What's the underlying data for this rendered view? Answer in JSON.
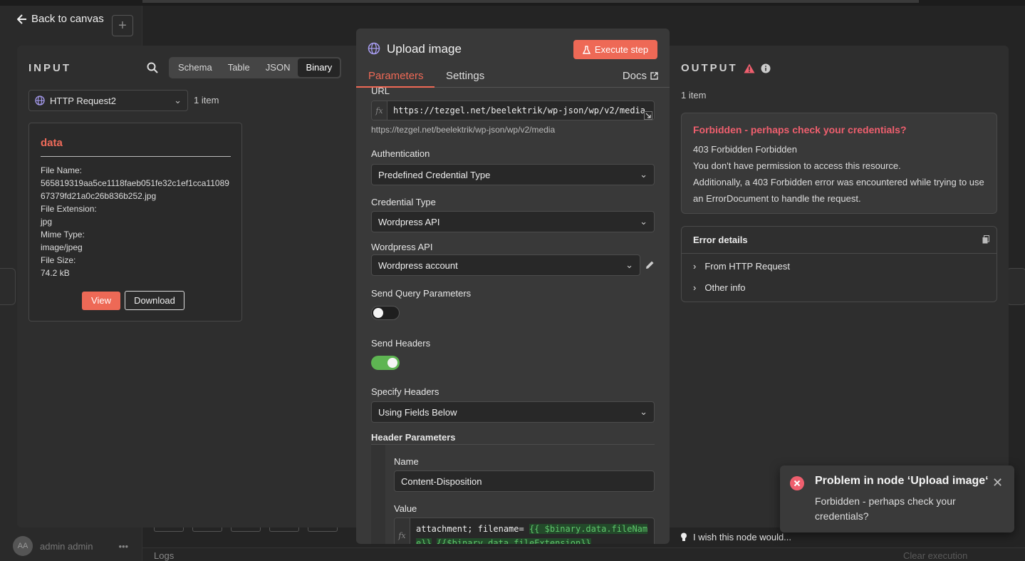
{
  "background": {
    "back_label": "Back to canvas",
    "user_name": "admin admin",
    "user_initials": "AA",
    "logs_label": "Logs",
    "clear_label": "Clear execution",
    "wish_label": "I wish this node would..."
  },
  "input": {
    "title": "INPUT",
    "views": [
      "Schema",
      "Table",
      "JSON",
      "Binary"
    ],
    "active_view": "Binary",
    "node_select": "HTTP Request2",
    "item_count": "1 item",
    "binary": {
      "key": "data",
      "file_name_label": "File Name:",
      "file_name": "565819319aa5ce1118faeb051fe32c1ef1cca1108967379fd21a0c26b836b252.jpg",
      "file_ext_label": "File Extension:",
      "file_ext": "jpg",
      "mime_label": "Mime Type:",
      "mime": "image/jpeg",
      "size_label": "File Size:",
      "size": "74.2 kB",
      "view_label": "View",
      "download_label": "Download"
    }
  },
  "node": {
    "title": "Upload image",
    "execute_label": "Execute step",
    "tabs": [
      "Parameters",
      "Settings"
    ],
    "docs_label": "Docs",
    "url_label": "URL",
    "url_value": "https://tezgel.net/beelektrik/wp-json/wp/v2/media",
    "url_hint": "https://tezgel.net/beelektrik/wp-json/wp/v2/media",
    "auth_label": "Authentication",
    "auth_value": "Predefined Credential Type",
    "cred_type_label": "Credential Type",
    "cred_type_value": "Wordpress API",
    "wp_api_label": "Wordpress API",
    "wp_api_value": "Wordpress account",
    "send_query_label": "Send Query Parameters",
    "send_query_on": false,
    "send_headers_label": "Send Headers",
    "send_headers_on": true,
    "specify_headers_label": "Specify Headers",
    "specify_headers_value": "Using Fields Below",
    "header_params_label": "Header Parameters",
    "name_label": "Name",
    "name_value": "Content-Disposition",
    "value_label": "Value",
    "value_prefix": "attachment; filename= ",
    "value_expr1": "{{ $binary.data.fileName}}",
    "value_expr2": "{{$binary.data.fileExtension}}"
  },
  "output": {
    "title": "OUTPUT",
    "item_count": "1 item",
    "error_title": "Forbidden - perhaps check your credentials?",
    "error_lines": [
      "403 Forbidden Forbidden",
      "You don't have permission to access this resource.",
      "Additionally, a 403 Forbidden error was encountered while trying to use an ErrorDocument to handle the request."
    ],
    "details_title": "Error details",
    "detail_rows": [
      "From HTTP Request",
      "Other info"
    ]
  },
  "toast": {
    "title": "Problem in node ‘Upload image‘",
    "message": "Forbidden - perhaps check your credentials?"
  },
  "colors": {
    "accent": "#ee6956",
    "error": "#ef5f6e",
    "toggle_on": "#5eb552",
    "expression": "#5fc76c"
  }
}
